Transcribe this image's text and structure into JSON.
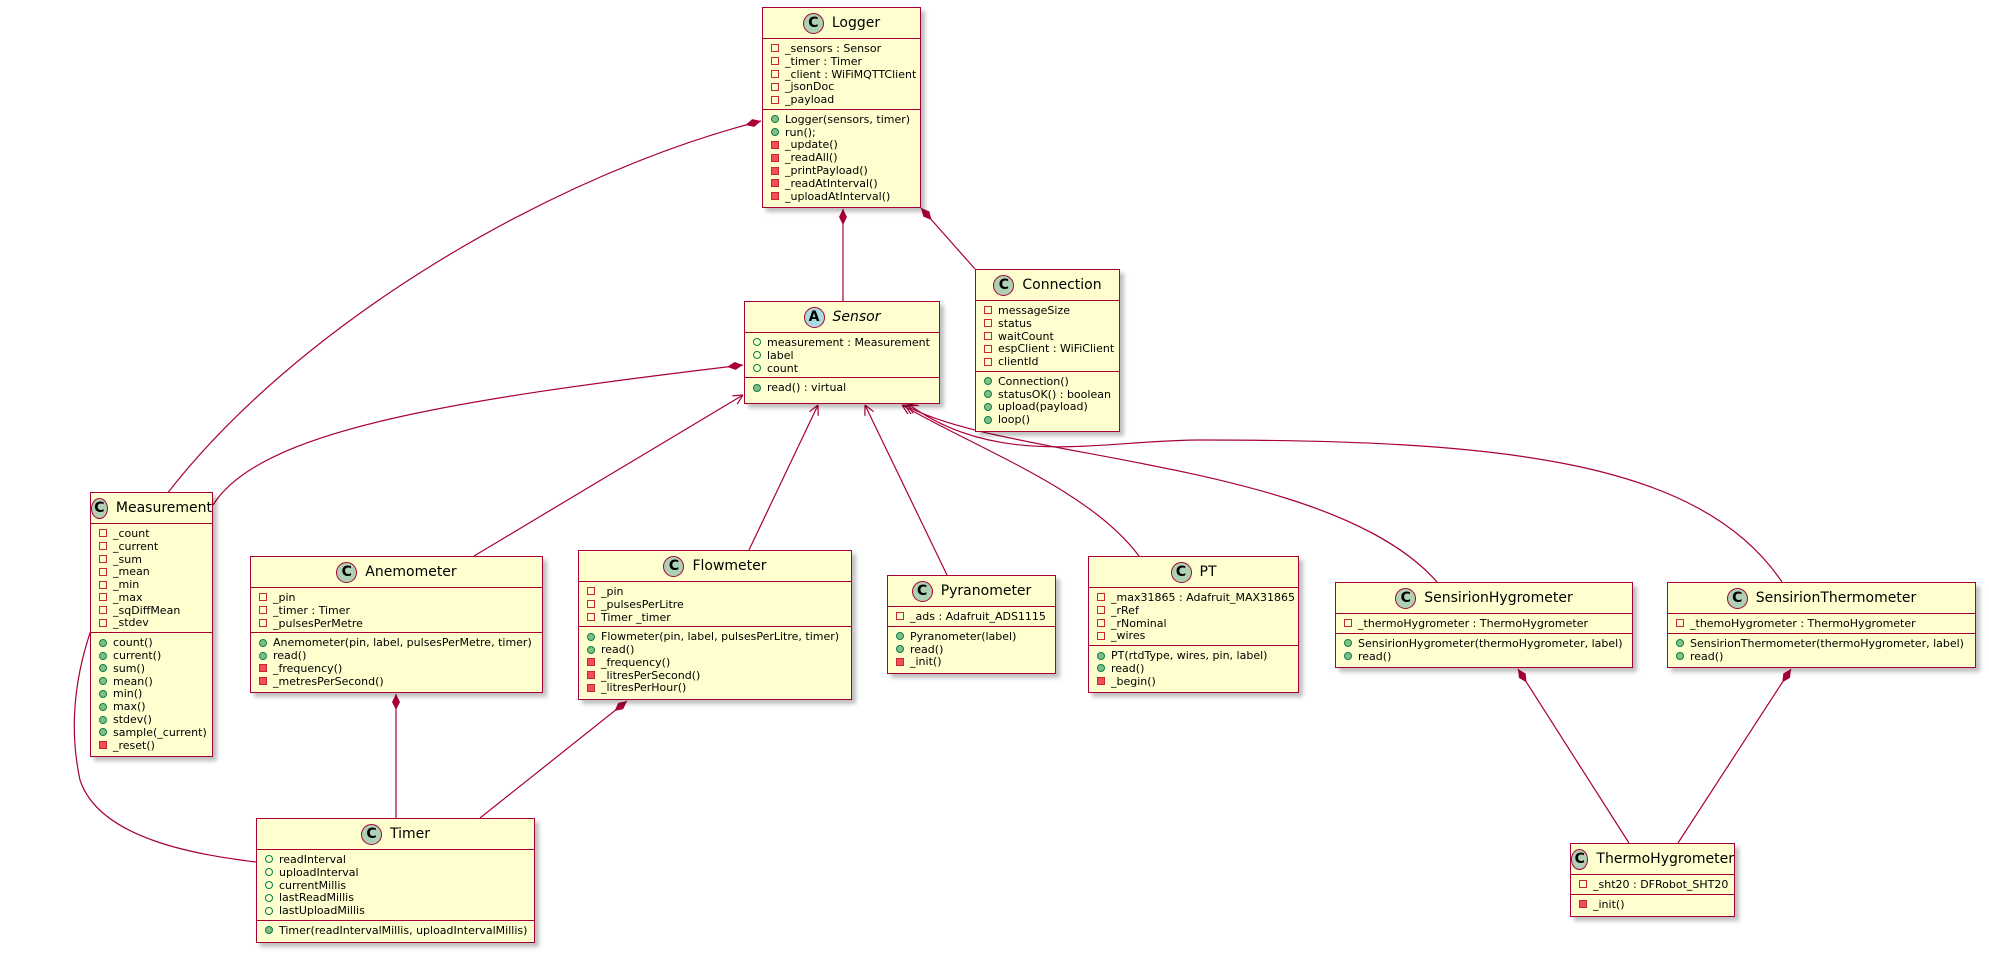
{
  "diagram": {
    "colors": {
      "box_fill": "#FEFECE",
      "border": "#A80036",
      "class_badge": "#ADD1B2",
      "abstract_badge": "#A9DCDF"
    },
    "classes": [
      {
        "name": "Logger",
        "kind": "C",
        "abstract": false,
        "attributes": [
          {
            "vis": "-",
            "text": "_sensors : Sensor"
          },
          {
            "vis": "-",
            "text": "_timer : Timer"
          },
          {
            "vis": "-",
            "text": "_client : WiFiMQTTClient"
          },
          {
            "vis": "-",
            "text": "_jsonDoc"
          },
          {
            "vis": "-",
            "text": "_payload"
          }
        ],
        "methods": [
          {
            "vis": "+",
            "text": "Logger(sensors, timer)"
          },
          {
            "vis": "+",
            "text": "run();"
          },
          {
            "vis": "-",
            "text": "_update()"
          },
          {
            "vis": "-",
            "text": "_readAll()"
          },
          {
            "vis": "-",
            "text": "_printPayload()"
          },
          {
            "vis": "-",
            "text": "_readAtInterval()"
          },
          {
            "vis": "-",
            "text": "_uploadAtInterval()"
          }
        ]
      },
      {
        "name": "Sensor",
        "kind": "A",
        "abstract": true,
        "attributes": [
          {
            "vis": "+",
            "text": "measurement : Measurement"
          },
          {
            "vis": "+",
            "text": "label"
          },
          {
            "vis": "+",
            "text": "count"
          }
        ],
        "methods": [
          {
            "vis": "+",
            "text": "read() : virtual"
          }
        ]
      },
      {
        "name": "Connection",
        "kind": "C",
        "abstract": false,
        "attributes": [
          {
            "vis": "-",
            "text": "messageSize"
          },
          {
            "vis": "-",
            "text": "status"
          },
          {
            "vis": "-",
            "text": "waitCount"
          },
          {
            "vis": "-",
            "text": "espClient : WiFiClient"
          },
          {
            "vis": "-",
            "text": "clientId"
          }
        ],
        "methods": [
          {
            "vis": "+",
            "text": "Connection()"
          },
          {
            "vis": "+",
            "text": "statusOK() : boolean"
          },
          {
            "vis": "+",
            "text": "upload(payload)"
          },
          {
            "vis": "+",
            "text": "loop()"
          }
        ]
      },
      {
        "name": "Measurement",
        "kind": "C",
        "abstract": false,
        "attributes": [
          {
            "vis": "-",
            "text": "_count"
          },
          {
            "vis": "-",
            "text": "_current"
          },
          {
            "vis": "-",
            "text": "_sum"
          },
          {
            "vis": "-",
            "text": "_mean"
          },
          {
            "vis": "-",
            "text": "_min"
          },
          {
            "vis": "-",
            "text": "_max"
          },
          {
            "vis": "-",
            "text": "_sqDiffMean"
          },
          {
            "vis": "-",
            "text": "_stdev"
          }
        ],
        "methods": [
          {
            "vis": "+",
            "text": "count()"
          },
          {
            "vis": "+",
            "text": "current()"
          },
          {
            "vis": "+",
            "text": "sum()"
          },
          {
            "vis": "+",
            "text": "mean()"
          },
          {
            "vis": "+",
            "text": "min()"
          },
          {
            "vis": "+",
            "text": "max()"
          },
          {
            "vis": "+",
            "text": "stdev()"
          },
          {
            "vis": "+",
            "text": "sample(_current)"
          },
          {
            "vis": "-",
            "text": "_reset()"
          }
        ]
      },
      {
        "name": "Anemometer",
        "kind": "C",
        "abstract": false,
        "attributes": [
          {
            "vis": "-",
            "text": "_pin"
          },
          {
            "vis": "-",
            "text": "_timer : Timer"
          },
          {
            "vis": "-",
            "text": "_pulsesPerMetre"
          }
        ],
        "methods": [
          {
            "vis": "+",
            "text": "Anemometer(pin, label, pulsesPerMetre, timer)"
          },
          {
            "vis": "+",
            "text": "read()"
          },
          {
            "vis": "-",
            "text": "_frequency()"
          },
          {
            "vis": "-",
            "text": "_metresPerSecond()"
          }
        ]
      },
      {
        "name": "Flowmeter",
        "kind": "C",
        "abstract": false,
        "attributes": [
          {
            "vis": "-",
            "text": "_pin"
          },
          {
            "vis": "-",
            "text": "_pulsesPerLitre"
          },
          {
            "vis": "-",
            "text": "Timer _timer"
          }
        ],
        "methods": [
          {
            "vis": "+",
            "text": "Flowmeter(pin, label, pulsesPerLitre, timer)"
          },
          {
            "vis": "+",
            "text": "read()"
          },
          {
            "vis": "-",
            "text": "_frequency()"
          },
          {
            "vis": "-",
            "text": "_litresPerSecond()"
          },
          {
            "vis": "-",
            "text": "_litresPerHour()"
          }
        ]
      },
      {
        "name": "Pyranometer",
        "kind": "C",
        "abstract": false,
        "attributes": [
          {
            "vis": "-",
            "text": "_ads : Adafruit_ADS1115"
          }
        ],
        "methods": [
          {
            "vis": "+",
            "text": "Pyranometer(label)"
          },
          {
            "vis": "+",
            "text": "read()"
          },
          {
            "vis": "-",
            "text": "_init()"
          }
        ]
      },
      {
        "name": "PT",
        "kind": "C",
        "abstract": false,
        "attributes": [
          {
            "vis": "-",
            "text": "_max31865 : Adafruit_MAX31865"
          },
          {
            "vis": "-",
            "text": "_rRef"
          },
          {
            "vis": "-",
            "text": "_rNominal"
          },
          {
            "vis": "-",
            "text": "_wires"
          }
        ],
        "methods": [
          {
            "vis": "+",
            "text": "PT(rtdType, wires, pin, label)"
          },
          {
            "vis": "+",
            "text": "read()"
          },
          {
            "vis": "-",
            "text": "_begin()"
          }
        ]
      },
      {
        "name": "SensirionHygrometer",
        "kind": "C",
        "abstract": false,
        "attributes": [
          {
            "vis": "-",
            "text": "_thermoHygrometer : ThermoHygrometer"
          }
        ],
        "methods": [
          {
            "vis": "+",
            "text": "SensirionHygrometer(thermoHygrometer, label)"
          },
          {
            "vis": "+",
            "text": "read()"
          }
        ]
      },
      {
        "name": "SensirionThermometer",
        "kind": "C",
        "abstract": false,
        "attributes": [
          {
            "vis": "-",
            "text": "_themoHygrometer : ThermoHygrometer"
          }
        ],
        "methods": [
          {
            "vis": "+",
            "text": "SensirionThermometer(thermoHygrometer, label)"
          },
          {
            "vis": "+",
            "text": "read()"
          }
        ]
      },
      {
        "name": "Timer",
        "kind": "C",
        "abstract": false,
        "attributes": [
          {
            "vis": "+",
            "text": "readInterval"
          },
          {
            "vis": "+",
            "text": "uploadInterval"
          },
          {
            "vis": "+",
            "text": "currentMillis"
          },
          {
            "vis": "+",
            "text": "lastReadMillis"
          },
          {
            "vis": "+",
            "text": "lastUploadMillis"
          }
        ],
        "methods": [
          {
            "vis": "+",
            "text": "Timer(readIntervalMillis, uploadIntervalMillis)"
          }
        ]
      },
      {
        "name": "ThermoHygrometer",
        "kind": "C",
        "abstract": false,
        "attributes": [
          {
            "vis": "-",
            "text": "_sht20 : DFRobot_SHT20"
          }
        ],
        "methods": [
          {
            "vis": "-",
            "text": "_init()"
          }
        ]
      }
    ],
    "relations": [
      {
        "from": "Logger",
        "to": "Timer",
        "type": "composition"
      },
      {
        "from": "Logger",
        "to": "Sensor",
        "type": "composition"
      },
      {
        "from": "Logger",
        "to": "Connection",
        "type": "composition"
      },
      {
        "from": "Sensor",
        "to": "Measurement",
        "type": "composition"
      },
      {
        "from": "Anemometer",
        "to": "Sensor",
        "type": "arrow"
      },
      {
        "from": "Flowmeter",
        "to": "Sensor",
        "type": "arrow"
      },
      {
        "from": "Pyranometer",
        "to": "Sensor",
        "type": "arrow"
      },
      {
        "from": "PT",
        "to": "Sensor",
        "type": "arrow"
      },
      {
        "from": "SensirionHygrometer",
        "to": "Sensor",
        "type": "arrow"
      },
      {
        "from": "SensirionThermometer",
        "to": "Sensor",
        "type": "arrow"
      },
      {
        "from": "Anemometer",
        "to": "Timer",
        "type": "composition"
      },
      {
        "from": "Flowmeter",
        "to": "Timer",
        "type": "composition"
      },
      {
        "from": "SensirionHygrometer",
        "to": "ThermoHygrometer",
        "type": "composition"
      },
      {
        "from": "SensirionThermometer",
        "to": "ThermoHygrometer",
        "type": "composition"
      }
    ]
  }
}
